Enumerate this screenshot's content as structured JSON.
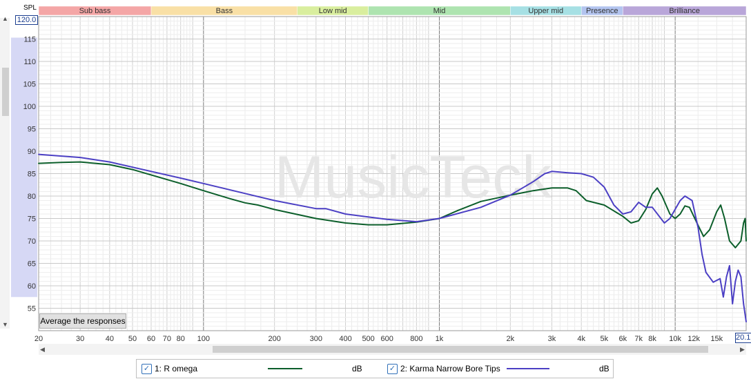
{
  "app": {
    "y_unit_label": "SPL",
    "watermark": "MusicTeck",
    "y_max_field": "120.0",
    "x_max_field": "20.1",
    "average_button_label": "Average the responses"
  },
  "bands": [
    {
      "label": "Sub bass",
      "from": 20,
      "to": 60,
      "color": "#f4a6a6"
    },
    {
      "label": "Bass",
      "from": 60,
      "to": 250,
      "color": "#f9e0a6"
    },
    {
      "label": "Low mid",
      "from": 250,
      "to": 500,
      "color": "#d9ee9e"
    },
    {
      "label": "Mid",
      "from": 500,
      "to": 2000,
      "color": "#aee4b0"
    },
    {
      "label": "Upper mid",
      "from": 2000,
      "to": 4000,
      "color": "#a6e0e4"
    },
    {
      "label": "Presence",
      "from": 4000,
      "to": 6000,
      "color": "#b3c4ef"
    },
    {
      "label": "Brilliance",
      "from": 6000,
      "to": 20000,
      "color": "#b9a6d9"
    }
  ],
  "legend": [
    {
      "label": "1: R omega",
      "unit": "dB",
      "color": "#0b5e2a",
      "checked": true
    },
    {
      "label": "2: Karma Narrow Bore Tips",
      "unit": "dB",
      "color": "#4b3fc4",
      "checked": true
    }
  ],
  "chart_data": {
    "type": "line",
    "xscale": "log",
    "xlim": [
      20,
      20000
    ],
    "ylim": [
      50,
      120
    ],
    "yticks": [
      55,
      60,
      65,
      70,
      75,
      80,
      85,
      90,
      95,
      100,
      105,
      110,
      115
    ],
    "xtick_labels": [
      {
        "v": 20,
        "t": "20"
      },
      {
        "v": 30,
        "t": "30"
      },
      {
        "v": 40,
        "t": "40"
      },
      {
        "v": 50,
        "t": "50"
      },
      {
        "v": 60,
        "t": "60"
      },
      {
        "v": 70,
        "t": "70"
      },
      {
        "v": 80,
        "t": "80"
      },
      {
        "v": 100,
        "t": "100"
      },
      {
        "v": 200,
        "t": "200"
      },
      {
        "v": 300,
        "t": "300"
      },
      {
        "v": 400,
        "t": "400"
      },
      {
        "v": 500,
        "t": "500"
      },
      {
        "v": 600,
        "t": "600"
      },
      {
        "v": 800,
        "t": "800"
      },
      {
        "v": 1000,
        "t": "1k"
      },
      {
        "v": 2000,
        "t": "2k"
      },
      {
        "v": 3000,
        "t": "3k"
      },
      {
        "v": 4000,
        "t": "4k"
      },
      {
        "v": 5000,
        "t": "5k"
      },
      {
        "v": 6000,
        "t": "6k"
      },
      {
        "v": 7000,
        "t": "7k"
      },
      {
        "v": 8000,
        "t": "8k"
      },
      {
        "v": 10000,
        "t": "10k"
      },
      {
        "v": 12000,
        "t": "12k"
      },
      {
        "v": 15000,
        "t": "15k"
      }
    ],
    "grid": true,
    "series": [
      {
        "name": "1: R omega",
        "color": "#0b5e2a",
        "points": [
          [
            20,
            87.3
          ],
          [
            25,
            87.5
          ],
          [
            30,
            87.6
          ],
          [
            40,
            87.0
          ],
          [
            50,
            85.9
          ],
          [
            60,
            84.7
          ],
          [
            80,
            82.8
          ],
          [
            100,
            81.2
          ],
          [
            130,
            79.4
          ],
          [
            150,
            78.5
          ],
          [
            170,
            78.0
          ],
          [
            200,
            77.0
          ],
          [
            300,
            75.0
          ],
          [
            400,
            74.0
          ],
          [
            500,
            73.6
          ],
          [
            600,
            73.6
          ],
          [
            800,
            74.2
          ],
          [
            1000,
            75.0
          ],
          [
            1200,
            76.8
          ],
          [
            1500,
            78.8
          ],
          [
            2000,
            80.2
          ],
          [
            2500,
            81.2
          ],
          [
            3000,
            81.8
          ],
          [
            3500,
            81.8
          ],
          [
            3800,
            81.2
          ],
          [
            4200,
            79.0
          ],
          [
            5000,
            78.0
          ],
          [
            6000,
            75.5
          ],
          [
            6500,
            74.0
          ],
          [
            7000,
            74.5
          ],
          [
            7500,
            77.0
          ],
          [
            8000,
            80.5
          ],
          [
            8400,
            81.8
          ],
          [
            8800,
            80.0
          ],
          [
            9500,
            76.0
          ],
          [
            10000,
            75.0
          ],
          [
            10500,
            76.0
          ],
          [
            11000,
            77.8
          ],
          [
            11500,
            77.5
          ],
          [
            12500,
            73.5
          ],
          [
            13200,
            71.0
          ],
          [
            14000,
            72.5
          ],
          [
            15000,
            76.5
          ],
          [
            15600,
            78.0
          ],
          [
            16200,
            75.0
          ],
          [
            17000,
            70.0
          ],
          [
            18000,
            68.5
          ],
          [
            19000,
            70.0
          ],
          [
            19500,
            74.0
          ],
          [
            19800,
            75.0
          ],
          [
            20000,
            70.0
          ]
        ]
      },
      {
        "name": "2: Karma Narrow Bore Tips",
        "color": "#4b3fc4",
        "points": [
          [
            20,
            89.3
          ],
          [
            30,
            88.6
          ],
          [
            40,
            87.6
          ],
          [
            60,
            85.5
          ],
          [
            80,
            84.0
          ],
          [
            100,
            82.8
          ],
          [
            200,
            79.0
          ],
          [
            300,
            77.2
          ],
          [
            330,
            77.2
          ],
          [
            400,
            76.0
          ],
          [
            600,
            74.8
          ],
          [
            800,
            74.3
          ],
          [
            1000,
            75.0
          ],
          [
            1500,
            77.5
          ],
          [
            2000,
            80.2
          ],
          [
            2500,
            83.2
          ],
          [
            2800,
            85.0
          ],
          [
            3000,
            85.5
          ],
          [
            3500,
            85.2
          ],
          [
            4000,
            85.0
          ],
          [
            4500,
            84.2
          ],
          [
            5000,
            82.0
          ],
          [
            5500,
            78.0
          ],
          [
            6000,
            76.0
          ],
          [
            6500,
            76.5
          ],
          [
            7000,
            78.6
          ],
          [
            7500,
            77.5
          ],
          [
            8000,
            77.5
          ],
          [
            9000,
            74.0
          ],
          [
            9500,
            75.0
          ],
          [
            10500,
            79.0
          ],
          [
            11000,
            80.0
          ],
          [
            11800,
            79.0
          ],
          [
            12500,
            73.0
          ],
          [
            13000,
            67.0
          ],
          [
            13500,
            63.0
          ],
          [
            14500,
            60.8
          ],
          [
            15500,
            61.6
          ],
          [
            16000,
            57.5
          ],
          [
            16500,
            62.0
          ],
          [
            17000,
            64.5
          ],
          [
            17500,
            56.0
          ],
          [
            18000,
            61.0
          ],
          [
            18500,
            63.5
          ],
          [
            19000,
            62.0
          ],
          [
            19500,
            56.0
          ],
          [
            20000,
            52.0
          ]
        ]
      }
    ]
  }
}
